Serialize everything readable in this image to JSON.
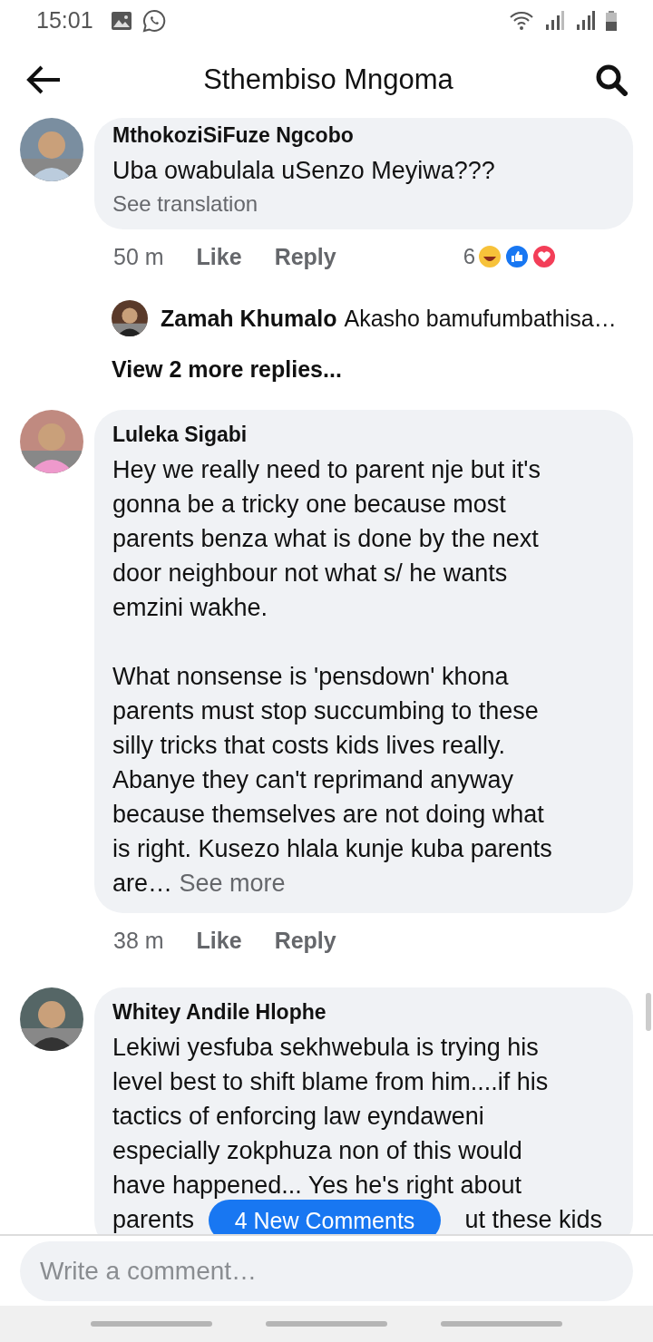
{
  "status_bar": {
    "time": "15:01"
  },
  "header": {
    "title": "Sthembiso Mngoma"
  },
  "comments": [
    {
      "author": "MthokoziSiFuze Ngcobo",
      "paragraphs": [
        [
          "Uba owabulala uSenzo Meyiwa???"
        ]
      ],
      "see_translation": "See translation",
      "time": "50 m",
      "like": "Like",
      "reply": "Reply",
      "reaction_count": "6",
      "replies": [
        {
          "author": "Zamah Khumalo",
          "text": "Akasho bamufumbathisa…"
        }
      ],
      "view_more": "View 2 more replies..."
    },
    {
      "author": "Luleka Sigabi",
      "paragraphs": [
        [
          "Hey we really need to parent nje but it's",
          "gonna be a tricky one because most",
          "parents benza what is done by the next",
          "door neighbour not what s/ he wants",
          "emzini wakhe."
        ],
        [
          "What nonsense is 'pensdown' khona",
          "parents must stop succumbing to these",
          "silly tricks that costs kids lives really.",
          "Abanye they can't reprimand anyway",
          "because themselves are not doing what",
          "is right. Kusezo hlala kunje kuba parents",
          "are…"
        ]
      ],
      "see_more": "See more",
      "time": "38 m",
      "like": "Like",
      "reply": "Reply"
    },
    {
      "author": "Whitey Andile Hlophe",
      "paragraphs": [
        [
          "Lekiwi yesfuba sekhwebula is trying his",
          "level best to shift blame from him....if his",
          "tactics of enforcing law eyndaweni",
          "especially zokphuza non of this would",
          "have happened... Yes he's right about"
        ]
      ],
      "covered_line": [
        "parents",
        "ut these kids"
      ]
    }
  ],
  "new_comments": "4 New Comments",
  "composer": {
    "placeholder": "Write a comment…"
  }
}
